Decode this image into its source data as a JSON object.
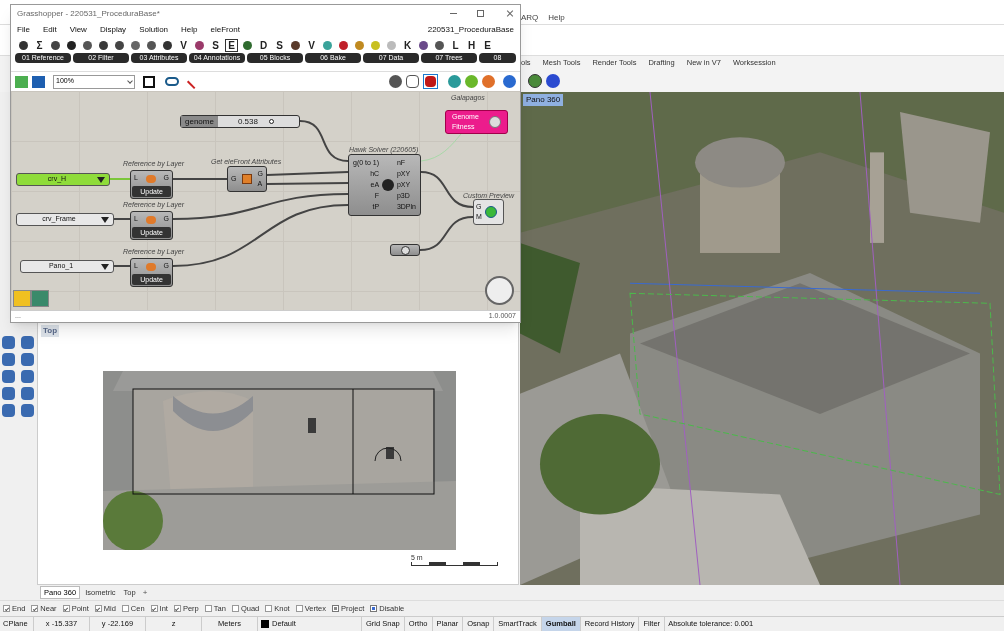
{
  "rhino": {
    "menu": [
      "ARQ",
      "Help"
    ],
    "tabs": [
      "ols",
      "Mesh Tools",
      "Render Tools",
      "Drafting",
      "New in V7",
      "Worksession"
    ],
    "main_viewport": {
      "label": "Pano 360",
      "kind": "picture"
    },
    "top_viewport": {
      "label": "Top",
      "scale": "5 m",
      "kind": "picture"
    },
    "viewport_tabs": [
      {
        "label": "Pano 360",
        "selected": true
      },
      {
        "label": "Isometric",
        "selected": false
      },
      {
        "label": "Top",
        "selected": false
      }
    ],
    "add_tab": "+",
    "osnaps": [
      {
        "label": "End",
        "checked": true,
        "kind": "snap"
      },
      {
        "label": "Near",
        "checked": true,
        "kind": "snap"
      },
      {
        "label": "Point",
        "checked": true,
        "kind": "snap"
      },
      {
        "label": "Mid",
        "checked": true,
        "kind": "snap"
      },
      {
        "label": "Cen",
        "checked": false,
        "kind": "snap"
      },
      {
        "label": "Int",
        "checked": true,
        "kind": "snap"
      },
      {
        "label": "Perp",
        "checked": true,
        "kind": "snap"
      },
      {
        "label": "Tan",
        "checked": false,
        "kind": "snap"
      },
      {
        "label": "Quad",
        "checked": false,
        "kind": "snap"
      },
      {
        "label": "Knot",
        "checked": false,
        "kind": "snap"
      },
      {
        "label": "Vertex",
        "checked": false,
        "kind": "snap"
      },
      {
        "label": "Project",
        "checked": true,
        "kind": "mode"
      },
      {
        "label": "Disable",
        "checked": true,
        "kind": "mode"
      }
    ],
    "status_panes": [
      {
        "text": "CPlane",
        "kind": "text"
      },
      {
        "text": "x -15.337",
        "kind": "coord"
      },
      {
        "text": "y -22.169",
        "kind": "coord"
      },
      {
        "text": "z",
        "kind": "coord"
      },
      {
        "text": "Meters",
        "kind": "coord"
      },
      {
        "text": "Default",
        "kind": "layer"
      }
    ],
    "status_toggles": [
      {
        "label": "Grid Snap",
        "selected": false
      },
      {
        "label": "Ortho",
        "selected": false
      },
      {
        "label": "Planar",
        "selected": false
      },
      {
        "label": "Osnap",
        "selected": false
      },
      {
        "label": "SmartTrack",
        "selected": false
      },
      {
        "label": "Gumball",
        "selected": true
      },
      {
        "label": "Record History",
        "selected": false
      },
      {
        "label": "Filter",
        "selected": false
      }
    ],
    "tolerance": "Absolute tolerance: 0.001"
  },
  "grasshopper": {
    "title": "Grasshopper - 220531_ProceduraBase*",
    "menu": [
      "File",
      "Edit",
      "View",
      "Display",
      "Solution",
      "Help",
      "eleFront"
    ],
    "document": "220531_ProceduraBase",
    "component_icons": [
      {
        "kind": "icon",
        "color": "#333333",
        "selected": false
      },
      {
        "kind": "glyph",
        "text": "Σ",
        "selected": false
      },
      {
        "kind": "icon",
        "color": "#444444",
        "selected": false
      },
      {
        "kind": "icon",
        "color": "#222222",
        "selected": false
      },
      {
        "kind": "icon",
        "color": "#555555",
        "selected": false
      },
      {
        "kind": "icon",
        "color": "#3a3a3a",
        "selected": false
      },
      {
        "kind": "icon",
        "color": "#444444",
        "selected": false
      },
      {
        "kind": "icon",
        "color": "#666666",
        "selected": false
      },
      {
        "kind": "icon",
        "color": "#555555",
        "selected": false
      },
      {
        "kind": "icon",
        "color": "#333333",
        "selected": false
      },
      {
        "kind": "glyph",
        "text": "V",
        "selected": false
      },
      {
        "kind": "icon",
        "color": "#9b3a6a",
        "selected": false
      },
      {
        "kind": "glyph",
        "text": "S",
        "selected": false
      },
      {
        "kind": "glyph",
        "text": "E",
        "selected": true
      },
      {
        "kind": "icon",
        "color": "#2f6b2f",
        "selected": false
      },
      {
        "kind": "glyph",
        "text": "D",
        "selected": false
      },
      {
        "kind": "glyph",
        "text": "S",
        "selected": false
      },
      {
        "kind": "icon",
        "color": "#5a3a2a",
        "selected": false
      },
      {
        "kind": "glyph",
        "text": "V",
        "selected": false
      },
      {
        "kind": "icon",
        "color": "#3aa39a",
        "selected": false
      },
      {
        "kind": "icon",
        "color": "#c0202a",
        "selected": false
      },
      {
        "kind": "icon",
        "color": "#c08a20",
        "selected": false
      },
      {
        "kind": "icon",
        "color": "#c8c020",
        "selected": false
      },
      {
        "kind": "icon",
        "color": "#bbbbbb",
        "selected": false
      },
      {
        "kind": "glyph",
        "text": "K",
        "selected": false
      },
      {
        "kind": "icon",
        "color": "#6a4a8a",
        "selected": false
      },
      {
        "kind": "icon",
        "color": "#555555",
        "selected": false
      },
      {
        "kind": "glyph",
        "text": "L",
        "selected": false
      },
      {
        "kind": "glyph",
        "text": "H",
        "selected": false
      },
      {
        "kind": "glyph",
        "text": "E",
        "selected": false
      }
    ],
    "categories": [
      "01 Reference",
      "02 Filter",
      "03 Attributes",
      "04 Annotations",
      "05 Blocks",
      "06 Bake",
      "07 Data",
      "07 Trees",
      "08"
    ],
    "zoom": "100%",
    "canvas": {
      "slider": {
        "name": "genome",
        "value": "0.538"
      },
      "galapagos": {
        "label": "Galapagos",
        "inputs": [
          "Genome",
          "Fitness"
        ]
      },
      "solver": {
        "label": "Hawk Solver (220605)",
        "inputs": [
          "g(0 to 1)",
          "hC",
          "eA",
          "F",
          "tP"
        ],
        "outputs": [
          "nF",
          "pXY",
          "pXY",
          "p3D",
          "3DPln"
        ]
      },
      "attributes": {
        "label": "Get eleFront Attributes",
        "input": "G",
        "outputs": [
          "G",
          "A"
        ]
      },
      "references": [
        {
          "label": "Reference by Layer",
          "input": "L",
          "output": "G",
          "button": "Update"
        },
        {
          "label": "Reference by Layer",
          "input": "L",
          "output": "G",
          "button": "Update"
        },
        {
          "label": "Reference by Layer",
          "input": "L",
          "output": "G",
          "button": "Update"
        }
      ],
      "value_lists": [
        {
          "value": "crv_H",
          "selected": true
        },
        {
          "value": "crv_Frame",
          "selected": false
        },
        {
          "value": "Pano_1",
          "selected": false
        }
      ],
      "preview": {
        "label": "Custom Preview",
        "inputs": [
          "G",
          "M"
        ]
      }
    },
    "status": "...",
    "version": "1.0.0007"
  }
}
